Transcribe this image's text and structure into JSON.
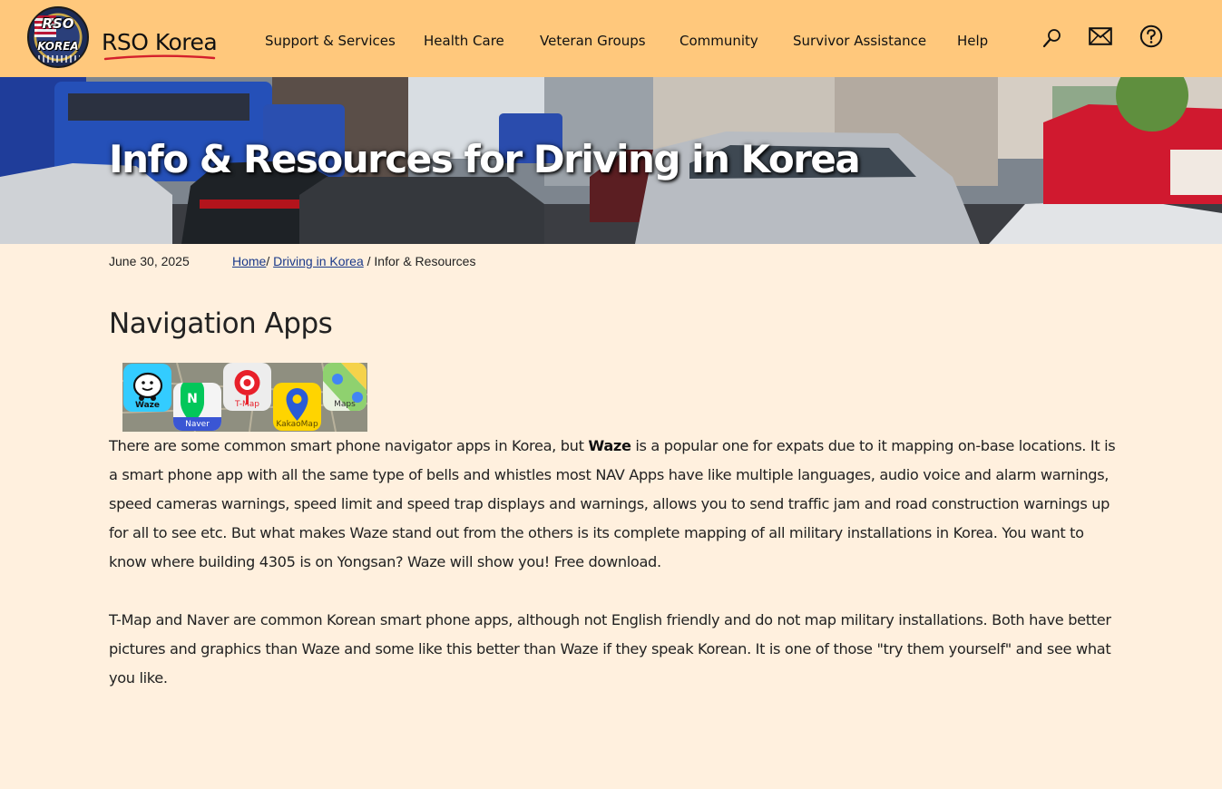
{
  "header": {
    "logo": {
      "line1": "RSO",
      "line2": "KOREA",
      "icon": "rso-korea-seal-icon"
    },
    "brand": "RSO Korea",
    "nav": [
      {
        "id": "support-services",
        "label": "Support & Services"
      },
      {
        "id": "health-care",
        "label": "Health Care"
      },
      {
        "id": "veteran-groups",
        "label": "Veteran Groups"
      },
      {
        "id": "community",
        "label": "Community"
      },
      {
        "id": "survivor-assistance",
        "label": "Survivor Assistance"
      },
      {
        "id": "help",
        "label": "Help"
      }
    ],
    "icons": [
      "search-icon",
      "mail-icon",
      "help-circle-icon"
    ],
    "background_color": "#ffc87c"
  },
  "hero": {
    "title": "Info & Resources for Driving in Korea"
  },
  "meta": {
    "date": "June 30, 2025",
    "breadcrumb": {
      "home": "Home",
      "sep1": "/",
      "section": "Driving in Korea",
      "sep2": "/",
      "current": "Infor & Resources"
    }
  },
  "content": {
    "section_title": "Navigation Apps",
    "apps": [
      {
        "name": "Waze",
        "icon": "waze-icon",
        "color": "#33ccff"
      },
      {
        "name": "Naver",
        "icon": "naver-map-icon",
        "color": "#03c75a"
      },
      {
        "name": "T-Map",
        "icon": "tmap-icon",
        "color": "#e8202a"
      },
      {
        "name": "KakaoMap",
        "icon": "kakaomap-icon",
        "color": "#ffd400"
      },
      {
        "name": "Maps",
        "icon": "google-maps-icon",
        "color": "#4285f4"
      }
    ],
    "p1": {
      "a": "There are some common smart phone navigator apps in Korea, but ",
      "b": "Waze",
      "c": " is a popular one for expats due to it mapping on-base locations. It is a smart phone app with all the same type of bells and whistles most NAV Apps have like multiple languages, audio voice and alarm warnings, speed cameras warnings, speed limit and speed trap displays and warnings, allows you to send traffic jam and road construction warnings up for all to see  etc. But what makes Waze stand out from the others is its complete mapping of all military installations in Korea. You want to know where building 4305 is on Yongsan? Waze will show you! Free download."
    },
    "p2": "T-Map and Naver are common Korean smart phone apps, although not English friendly and do not map military installations. Both have better pictures and graphics than Waze and some like this better than Waze if they speak Korean.  It is one of those \"try them yourself\" and see what you like."
  },
  "colors": {
    "page_background": "#fff0de",
    "link": "#1a3a8a"
  }
}
